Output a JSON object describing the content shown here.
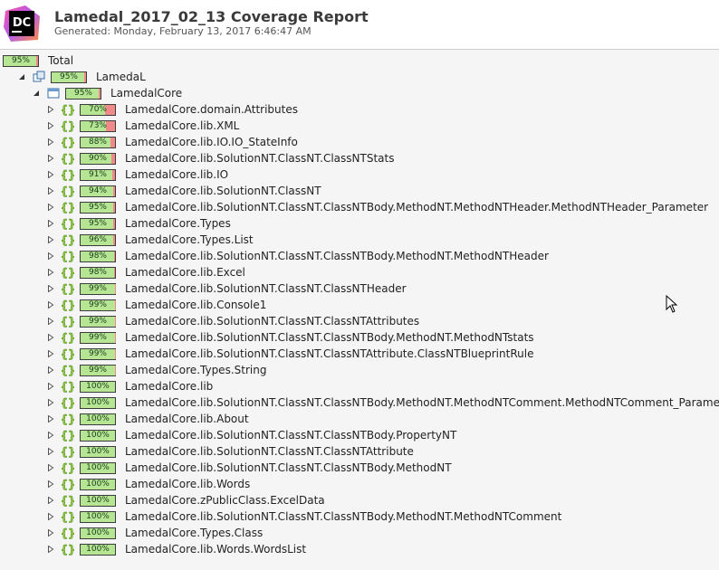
{
  "header": {
    "logo_text": "DC",
    "title": "Lamedal_2017_02_13 Coverage Report",
    "generated": "Generated: Monday, February 13, 2017 6:46:47 AM"
  },
  "tree": {
    "total": {
      "label": "Total",
      "percent": "95%",
      "coverage": 0.95
    },
    "assembly": {
      "label": "LamedaL",
      "percent": "95%",
      "coverage": 0.95,
      "icon": "assembly-icon"
    },
    "module": {
      "label": "LamedalCore",
      "percent": "95%",
      "coverage": 0.95,
      "icon": "module-icon"
    },
    "namespaces": [
      {
        "label": "LamedalCore.domain.Attributes",
        "percent": "70%",
        "coverage": 0.7
      },
      {
        "label": "LamedalCore.lib.XML",
        "percent": "73%",
        "coverage": 0.73
      },
      {
        "label": "LamedalCore.lib.IO.IO_StateInfo",
        "percent": "88%",
        "coverage": 0.88
      },
      {
        "label": "LamedalCore.lib.SolutionNT.ClassNT.ClassNTStats",
        "percent": "90%",
        "coverage": 0.9
      },
      {
        "label": "LamedalCore.lib.IO",
        "percent": "91%",
        "coverage": 0.91
      },
      {
        "label": "LamedalCore.lib.SolutionNT.ClassNT",
        "percent": "94%",
        "coverage": 0.94
      },
      {
        "label": "LamedalCore.lib.SolutionNT.ClassNT.ClassNTBody.MethodNT.MethodNTHeader.MethodNTHeader_Parameter",
        "percent": "95%",
        "coverage": 0.95
      },
      {
        "label": "LamedalCore.Types",
        "percent": "95%",
        "coverage": 0.95
      },
      {
        "label": "LamedalCore.Types.List",
        "percent": "96%",
        "coverage": 0.96
      },
      {
        "label": "LamedalCore.lib.SolutionNT.ClassNT.ClassNTBody.MethodNT.MethodNTHeader",
        "percent": "98%",
        "coverage": 0.98
      },
      {
        "label": "LamedalCore.lib.Excel",
        "percent": "98%",
        "coverage": 0.98
      },
      {
        "label": "LamedalCore.lib.SolutionNT.ClassNT.ClassNTHeader",
        "percent": "99%",
        "coverage": 0.99
      },
      {
        "label": "LamedalCore.lib.Console1",
        "percent": "99%",
        "coverage": 0.99
      },
      {
        "label": "LamedalCore.lib.SolutionNT.ClassNT.ClassNTAttributes",
        "percent": "99%",
        "coverage": 0.99
      },
      {
        "label": "LamedalCore.lib.SolutionNT.ClassNT.ClassNTBody.MethodNT.MethodNTstats",
        "percent": "99%",
        "coverage": 0.99
      },
      {
        "label": "LamedalCore.lib.SolutionNT.ClassNT.ClassNTAttribute.ClassNTBlueprintRule",
        "percent": "99%",
        "coverage": 0.99
      },
      {
        "label": "LamedalCore.Types.String",
        "percent": "99%",
        "coverage": 0.99
      },
      {
        "label": "LamedalCore.lib",
        "percent": "100%",
        "coverage": 1.0
      },
      {
        "label": "LamedalCore.lib.SolutionNT.ClassNT.ClassNTBody.MethodNT.MethodNTComment.MethodNTComment_Parameter",
        "percent": "100%",
        "coverage": 1.0
      },
      {
        "label": "LamedalCore.lib.About",
        "percent": "100%",
        "coverage": 1.0
      },
      {
        "label": "LamedalCore.lib.SolutionNT.ClassNT.ClassNTBody.PropertyNT",
        "percent": "100%",
        "coverage": 1.0
      },
      {
        "label": "LamedalCore.lib.SolutionNT.ClassNT.ClassNTAttribute",
        "percent": "100%",
        "coverage": 1.0
      },
      {
        "label": "LamedalCore.lib.SolutionNT.ClassNT.ClassNTBody.MethodNT",
        "percent": "100%",
        "coverage": 1.0
      },
      {
        "label": "LamedalCore.lib.Words",
        "percent": "100%",
        "coverage": 1.0
      },
      {
        "label": "LamedalCore.zPublicClass.ExcelData",
        "percent": "100%",
        "coverage": 1.0
      },
      {
        "label": "LamedalCore.lib.SolutionNT.ClassNT.ClassNTBody.MethodNT.MethodNTComment",
        "percent": "100%",
        "coverage": 1.0
      },
      {
        "label": "LamedalCore.Types.Class",
        "percent": "100%",
        "coverage": 1.0
      },
      {
        "label": "LamedalCore.lib.Words.WordsList",
        "percent": "100%",
        "coverage": 1.0
      }
    ]
  },
  "colors": {
    "covered": "#b6e694",
    "uncovered": "#f08a8a",
    "namespace_icon": "#8fcc3a"
  }
}
